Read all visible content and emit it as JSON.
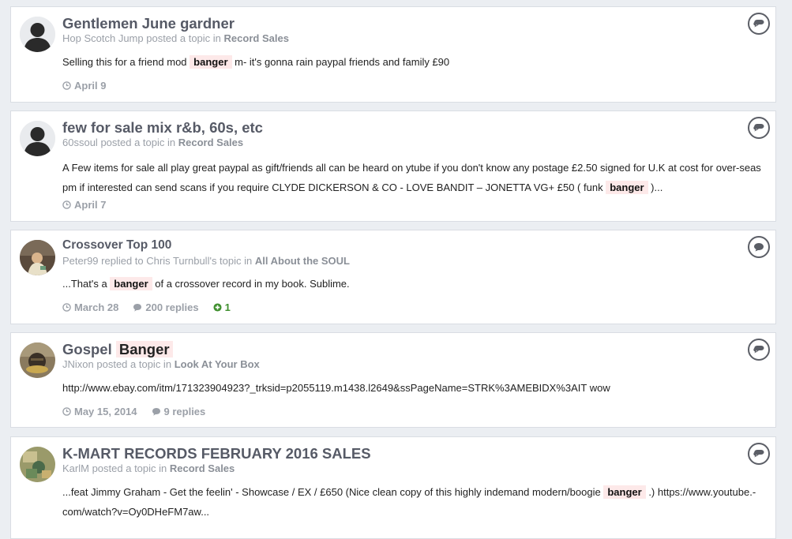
{
  "results": [
    {
      "title": "Gentlemen June gardner",
      "title_highlight": "",
      "author": "Hop Scotch Jump",
      "action": "posted a topic in",
      "forum": "Record Sales",
      "snippet_before": "Selling this for a friend mod",
      "snippet_highlight": "banger",
      "snippet_after": "m- it's gonna rain paypal friends and family £90",
      "date": "April 9",
      "replies": "",
      "reputation": "",
      "avatar": "default-avatar"
    },
    {
      "title": "few for sale mix r&b, 60s, etc",
      "title_highlight": "",
      "author": "60ssoul",
      "action": "posted a topic in",
      "forum": "Record Sales",
      "snippet_before": "A Few items for sale all play great paypal as gift/friends all can be heard on ytube if you don't know any postage £2.50 signed for U.K at cost for over-seas pm if interested can send scans if you require CLYDE DICKERSON & CO - LOVE BANDIT – JONETTA VG+ £50 ( funk",
      "snippet_highlight": "banger",
      "snippet_after": ")...",
      "date": "April 7",
      "replies": "",
      "reputation": "",
      "avatar": "default-avatar"
    },
    {
      "title": "Crossover Top 100",
      "title_highlight": "",
      "author": "Peter99",
      "action": "replied to Chris Turnbull's topic in",
      "forum": "All About the SOUL",
      "snippet_before": "...That's a",
      "snippet_highlight": "banger",
      "snippet_after": "of a crossover record in my book. Sublime.",
      "date": "March 28",
      "replies": "200 replies",
      "reputation": "1",
      "avatar": "photo-avatar-peter99"
    },
    {
      "title": "Gospel",
      "title_highlight": "Banger",
      "author": "JNixon",
      "action": "posted a topic in",
      "forum": "Look At Your Box",
      "snippet_before": "http://www.ebay.com/itm/171323904923?_trksid=p2055119.m1438.l2649&ssPageName=STRK%3AMEBIDX%3AIT wow",
      "snippet_highlight": "",
      "snippet_after": "",
      "date": "May 15, 2014",
      "replies": "9 replies",
      "reputation": "",
      "avatar": "photo-avatar-jnixon"
    },
    {
      "title": "K-MART RECORDS FEBRUARY 2016 SALES",
      "title_highlight": "",
      "author": "KarlM",
      "action": "posted a topic in",
      "forum": "Record Sales",
      "snippet_before": "...feat Jimmy Graham - Get the feelin' - Showcase / EX / £650 (Nice clean copy of this highly indemand modern/boogie",
      "snippet_highlight": "banger",
      "snippet_after": ".) https://www.youtube.-com/watch?v=Oy0DHeFM7aw...",
      "date": "",
      "replies": "",
      "reputation": "",
      "avatar": "photo-avatar-karlm"
    }
  ],
  "colors": {
    "highlight": "#fde9e9",
    "reputation": "#3f8f2e",
    "meta": "#9ba0a8"
  },
  "icons": {
    "date": "clock-icon",
    "replies": "comment-icon",
    "reputation": "plus-circle-icon",
    "type": "chat-bubble-icon"
  }
}
